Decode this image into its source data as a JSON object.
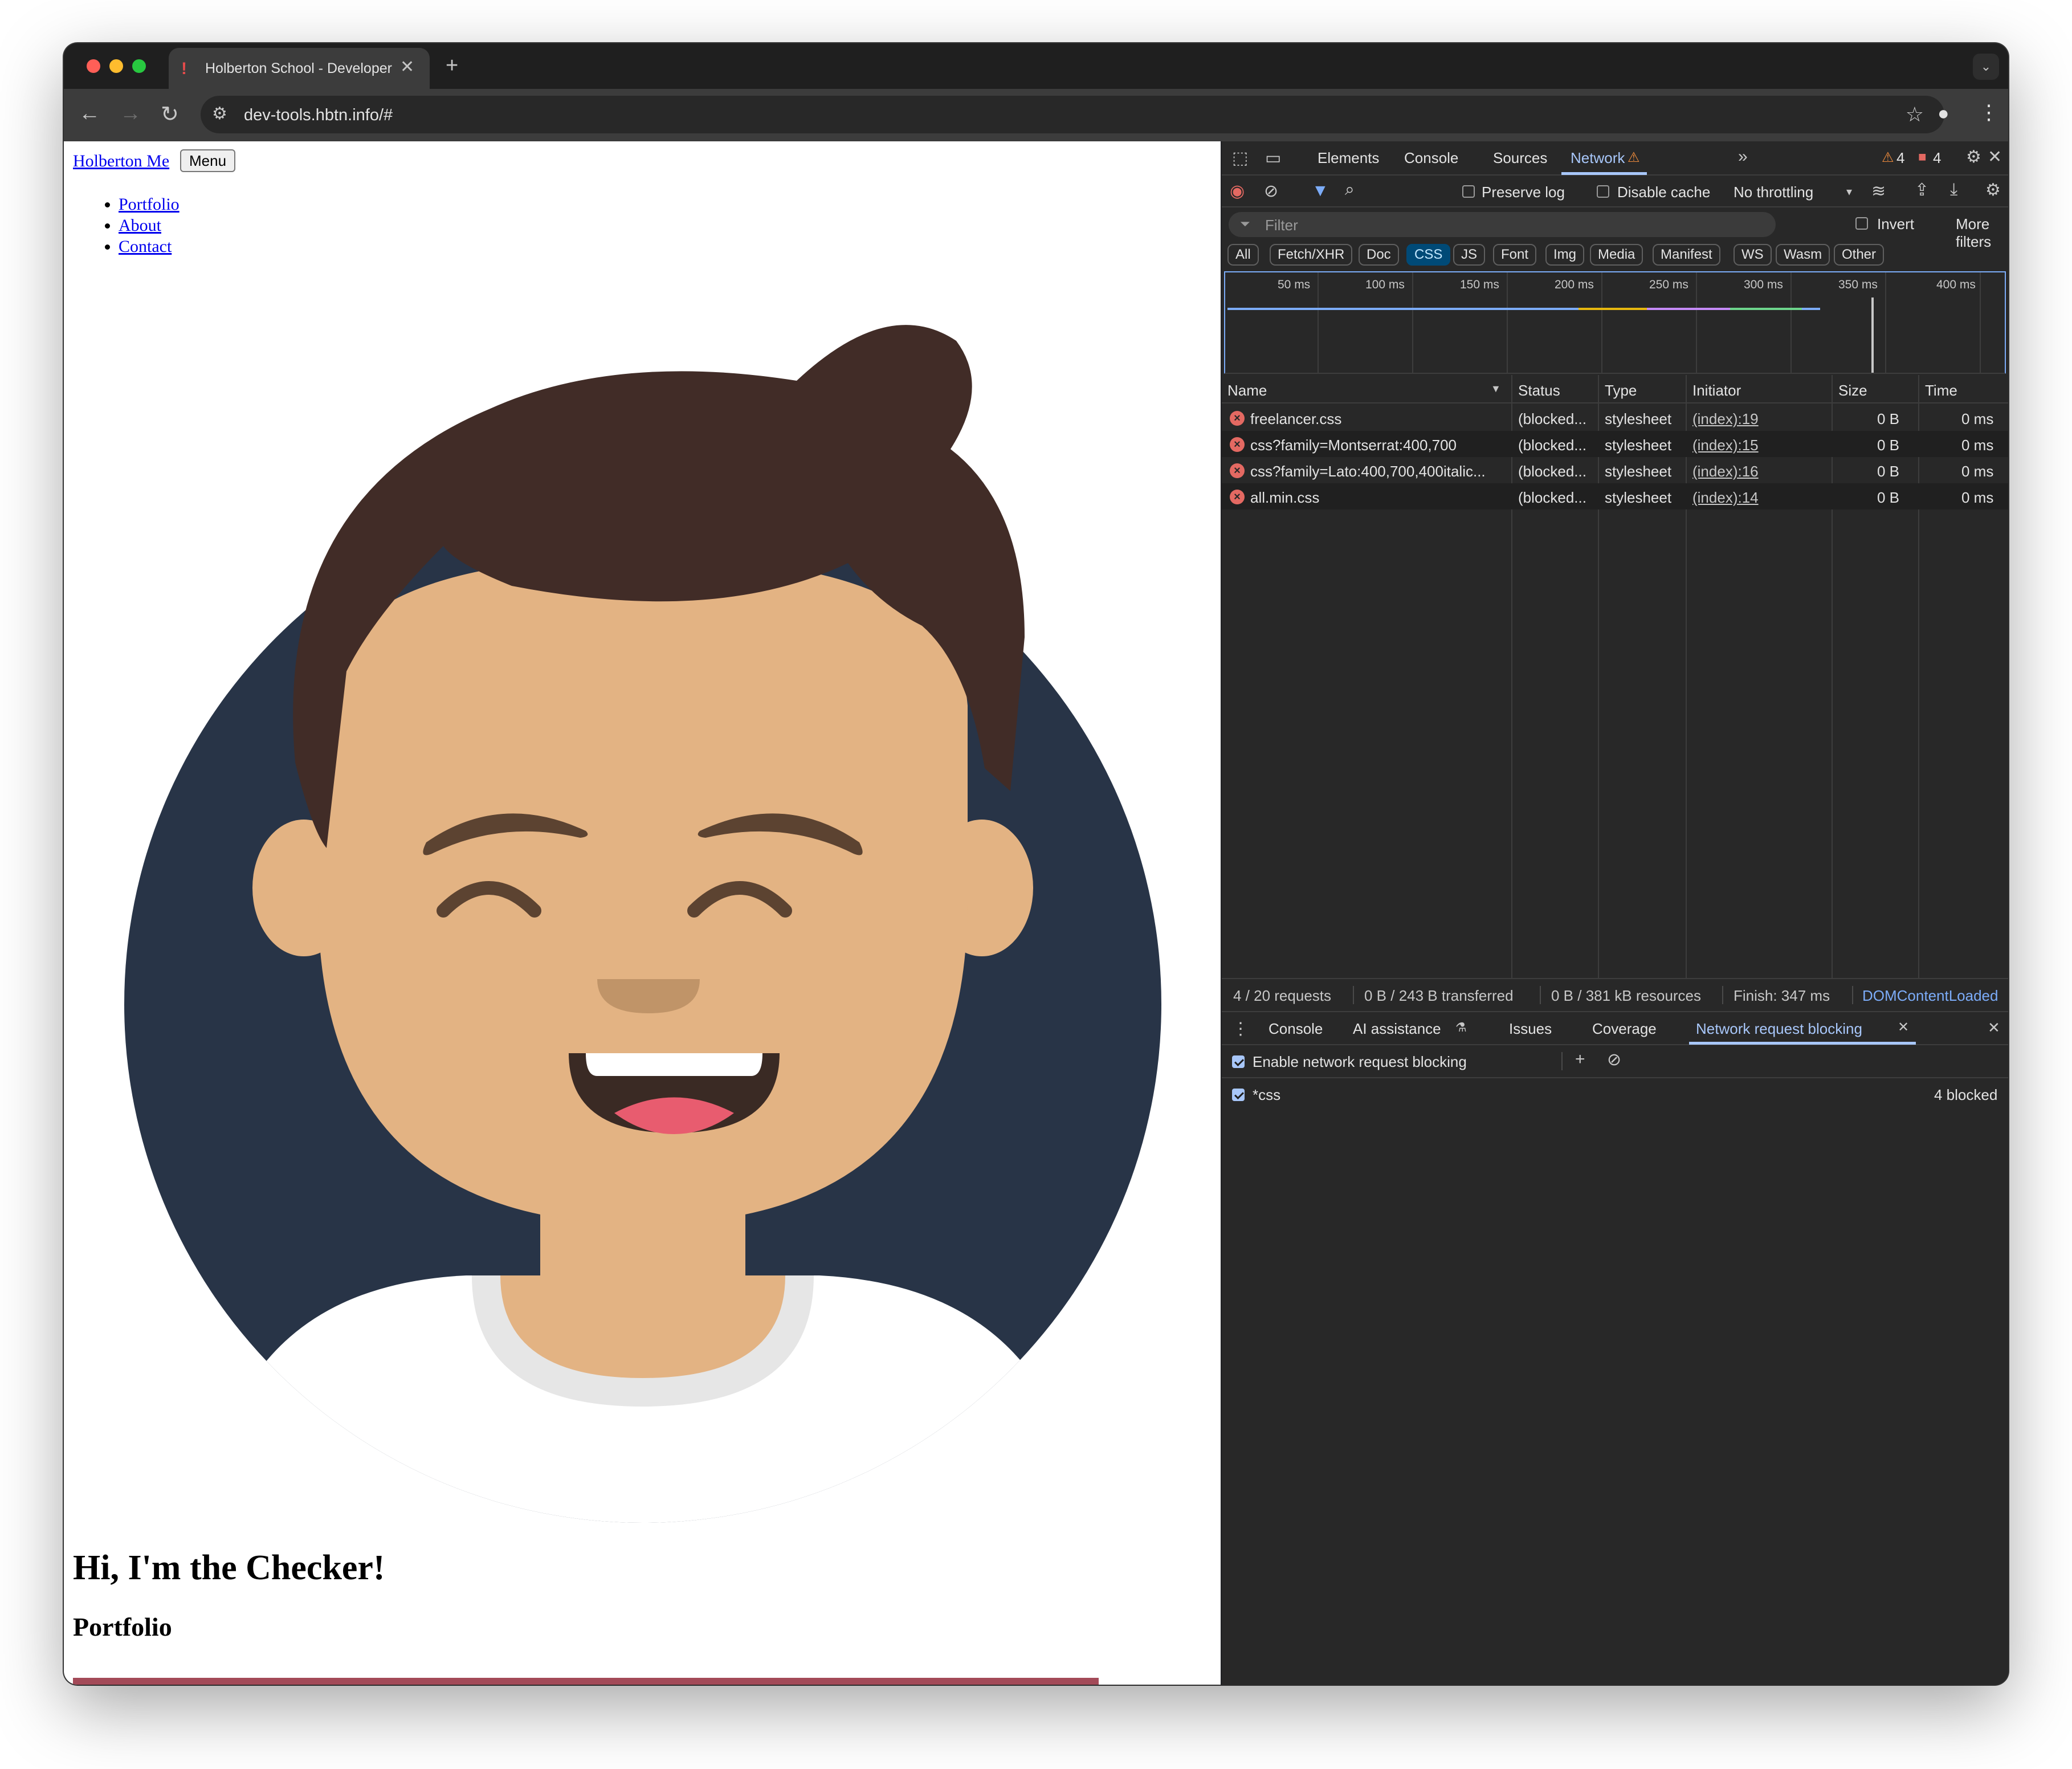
{
  "browser": {
    "tab_title": "Holberton School - Developer Tools",
    "url": "dev-tools.hbtn.info/#"
  },
  "page": {
    "brand_link": "Holberton Me",
    "menu_button": "Menu",
    "nav_items": [
      "Portfolio",
      "About",
      "Contact"
    ],
    "heading": "Hi, I'm the Checker!",
    "section_heading": "Portfolio",
    "colors": {
      "avatar_bg": "#283447",
      "hair": "#412c27",
      "skin": "#e3b383",
      "band": "#a34a58"
    }
  },
  "devtools": {
    "tabs": [
      "Elements",
      "Console",
      "Sources",
      "Network"
    ],
    "active_tab": "Network",
    "warning_count": "4",
    "error_count": "4",
    "toolbar": {
      "preserve_log": "Preserve log",
      "disable_cache": "Disable cache",
      "throttling": "No throttling"
    },
    "filter": {
      "placeholder": "Filter",
      "invert": "Invert",
      "more_filters": "More filters"
    },
    "type_filters": [
      "All",
      "Fetch/XHR",
      "Doc",
      "CSS",
      "JS",
      "Font",
      "Img",
      "Media",
      "Manifest",
      "WS",
      "Wasm",
      "Other"
    ],
    "active_type_filter": "CSS",
    "timeline_ticks": [
      "50 ms",
      "100 ms",
      "150 ms",
      "200 ms",
      "250 ms",
      "300 ms",
      "350 ms",
      "400 ms"
    ],
    "columns": [
      "Name",
      "Status",
      "Type",
      "Initiator",
      "Size",
      "Time"
    ],
    "requests": [
      {
        "name": "freelancer.css",
        "status": "(blocked...",
        "type": "stylesheet",
        "initiator": "(index):19",
        "size": "0 B",
        "time": "0 ms"
      },
      {
        "name": "css?family=Montserrat:400,700",
        "status": "(blocked...",
        "type": "stylesheet",
        "initiator": "(index):15",
        "size": "0 B",
        "time": "0 ms"
      },
      {
        "name": "css?family=Lato:400,700,400italic...",
        "status": "(blocked...",
        "type": "stylesheet",
        "initiator": "(index):16",
        "size": "0 B",
        "time": "0 ms"
      },
      {
        "name": "all.min.css",
        "status": "(blocked...",
        "type": "stylesheet",
        "initiator": "(index):14",
        "size": "0 B",
        "time": "0 ms"
      }
    ],
    "summary": {
      "requests": "4 / 20 requests",
      "transferred": "0 B / 243 B transferred",
      "resources": "0 B / 381 kB resources",
      "finish": "Finish: 347 ms",
      "dcl": "DOMContentLoaded"
    },
    "drawer": {
      "tabs": [
        "Console",
        "AI assistance",
        "Issues",
        "Coverage",
        "Network request blocking"
      ],
      "active_tab": "Network request blocking",
      "enable_label": "Enable network request blocking",
      "pattern": "*css",
      "blocked_count": "4 blocked"
    }
  }
}
